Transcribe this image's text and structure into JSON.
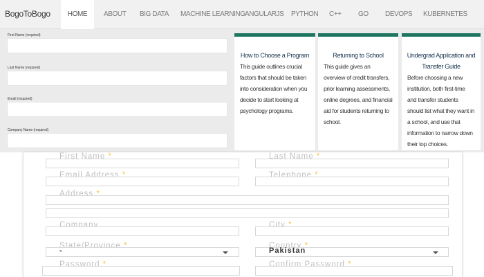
{
  "brand": "BogoToBogo",
  "nav": [
    "HOME",
    "ABOUT",
    "BIG DATA",
    "MACHINE LEARNING",
    "ANGULARJS",
    "PYTHON",
    "C++",
    "GO",
    "DEVOPS",
    "KUBERNETES"
  ],
  "mini_form": {
    "labels": [
      "First Name (required)",
      "Last Name (required)",
      "Email (required)",
      "Company Name (required)"
    ]
  },
  "cards": [
    {
      "title": "How to Choose a Program",
      "body": "This guide outlines crucial factors that should be taken into consideration when you decide to start looking at psychology programs."
    },
    {
      "title": "Returning to School",
      "body": "This guide gives an overview of credit transfers, prior learning assessments, online degrees, and financial aid for students returning to school."
    },
    {
      "title": "Undergrad Application and Transfer Guide",
      "body": "Before choosing a new institution, both first-time and transfer students should list what they want in a school, and use that information to narrow down their top choices."
    }
  ],
  "form": {
    "first_name": "First Name",
    "last_name": "Last Name",
    "email": "Email Address",
    "telephone": "Telephone",
    "address": "Address",
    "company": "Company",
    "city": "City",
    "state": "State/Province",
    "state_value": "-",
    "country": "Country",
    "country_value": "Pakistan",
    "password": "Password",
    "confirm_password": "Confirm Password",
    "req": "*"
  },
  "colors": {
    "card_accent": "#1e7662",
    "required": "#f2c84b"
  }
}
